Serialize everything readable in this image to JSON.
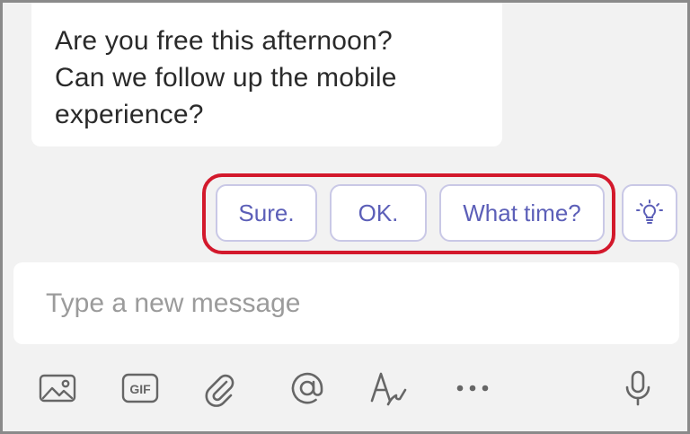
{
  "message": {
    "lines": [
      "Are you free this afternoon?",
      "Can we follow up the mobile",
      "experience?"
    ]
  },
  "suggested_replies": [
    {
      "label": "Sure."
    },
    {
      "label": "OK."
    },
    {
      "label": "What time?"
    }
  ],
  "suggestions_icon": "lightbulb-icon",
  "compose": {
    "placeholder": "Type a new message"
  },
  "toolbar": {
    "icons": [
      "image-icon",
      "gif-icon",
      "paperclip-icon",
      "at-mention-icon",
      "format-text-icon",
      "more-options-icon",
      "microphone-icon"
    ],
    "gif_label": "GIF"
  },
  "colors": {
    "accent": "#5c5fb8",
    "highlight": "#d3192c",
    "icon": "#666666",
    "background": "#f2f2f2"
  }
}
